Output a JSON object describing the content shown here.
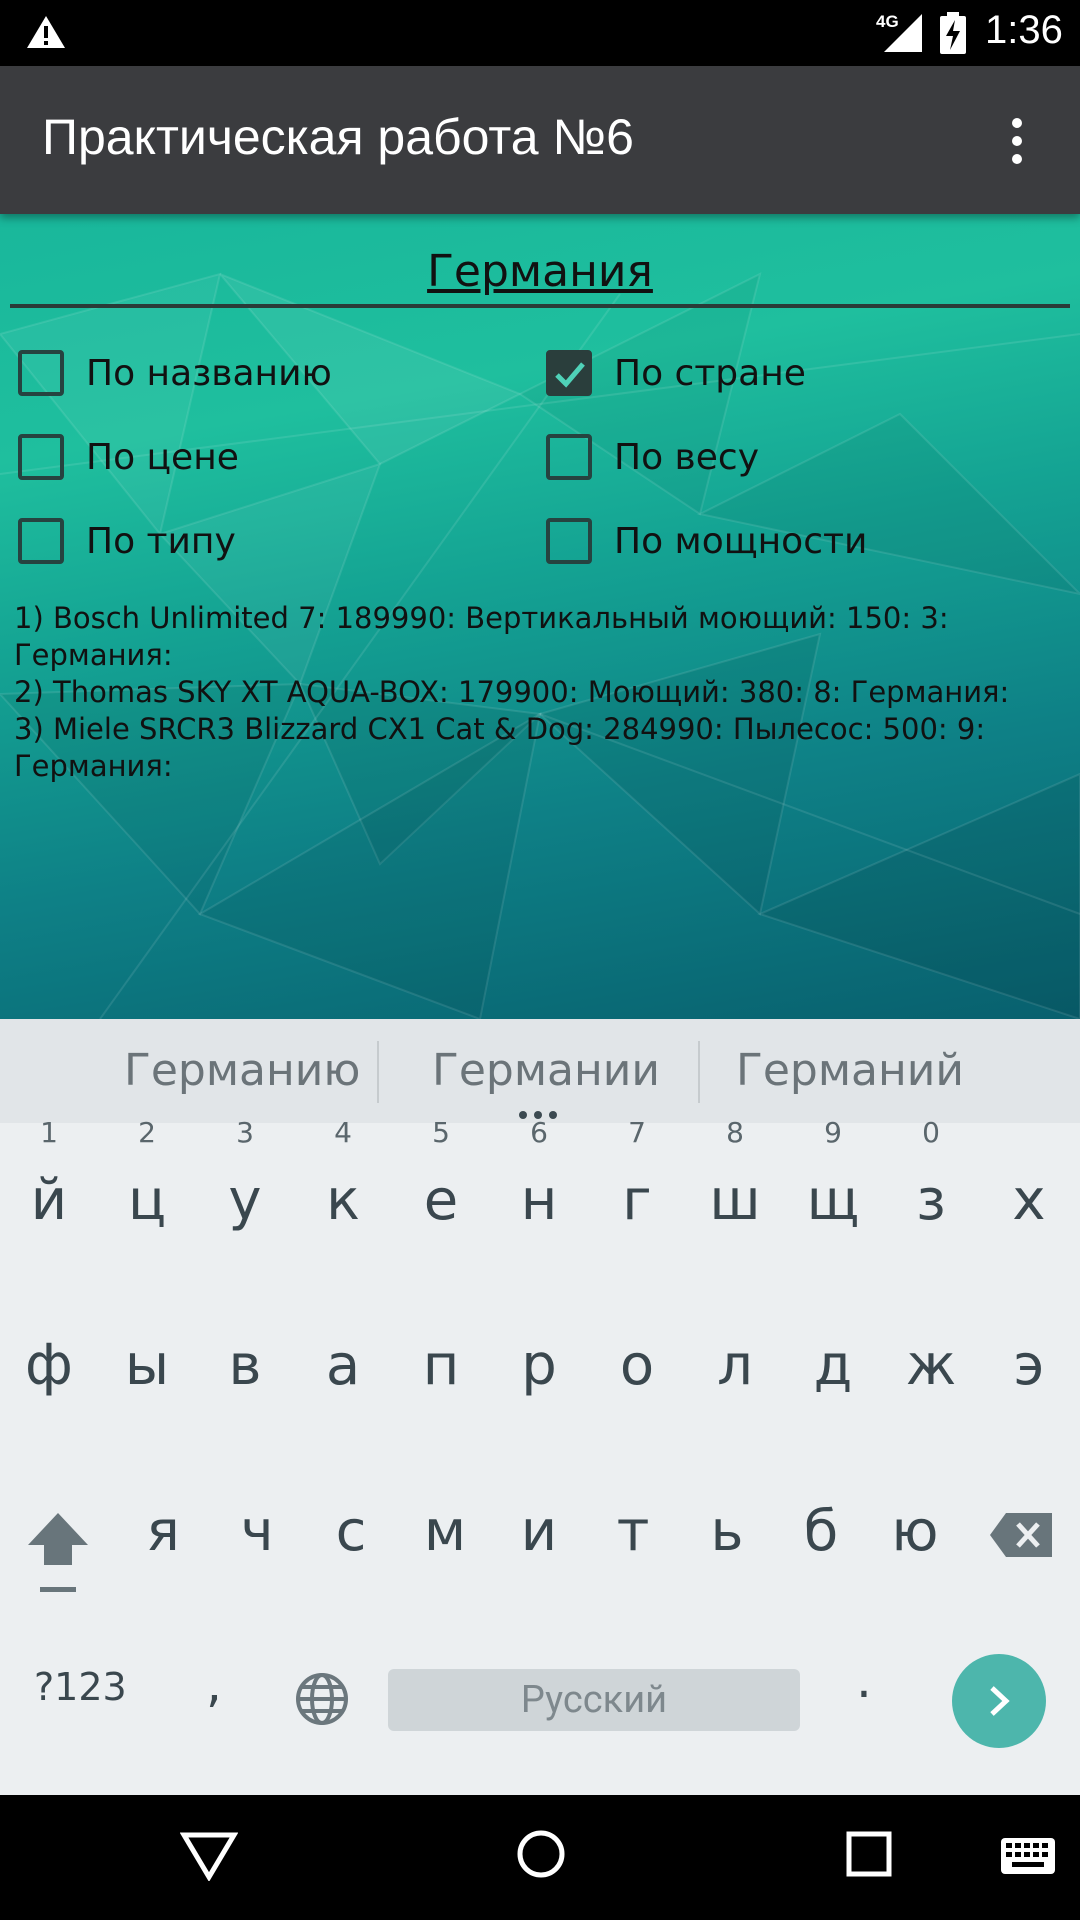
{
  "status_bar": {
    "time": "1:36",
    "network": "4G",
    "icons": [
      "warning-icon",
      "signal-icon",
      "battery-charging-icon"
    ]
  },
  "app_bar": {
    "title": "Практическая работа №6",
    "menu_icon": "overflow-menu-icon"
  },
  "search": {
    "value": "Германия"
  },
  "filters": [
    {
      "label": "По названию",
      "checked": false
    },
    {
      "label": "По стране",
      "checked": true
    },
    {
      "label": "По цене",
      "checked": false
    },
    {
      "label": "По весу",
      "checked": false
    },
    {
      "label": "По типу",
      "checked": false
    },
    {
      "label": "По мощности",
      "checked": false
    }
  ],
  "results": [
    "1) Bosch Unlimited 7: 189990: Вертикальный моющий: 150: 3: Германия:",
    "2) Thomas SKY XT AQUA-BOX: 179900: Моющий: 380: 8: Германия:",
    "3) Miele SRCR3 Blizzard CX1 Cat & Dog: 284990: Пылесос: 500: 9: Германия:"
  ],
  "keyboard": {
    "suggestions": [
      "Германию",
      "Германии",
      "Германий"
    ],
    "row1": [
      "й",
      "ц",
      "у",
      "к",
      "е",
      "н",
      "г",
      "ш",
      "щ",
      "з",
      "х"
    ],
    "row1_hints": [
      "1",
      "2",
      "3",
      "4",
      "5",
      "6",
      "7",
      "8",
      "9",
      "0",
      ""
    ],
    "row2": [
      "ф",
      "ы",
      "в",
      "а",
      "п",
      "р",
      "о",
      "л",
      "д",
      "ж",
      "э"
    ],
    "row3": [
      "я",
      "ч",
      "с",
      "м",
      "и",
      "т",
      "ь",
      "б",
      "ю"
    ],
    "symbols_label": "?123",
    "comma": ",",
    "space_label": "Русский",
    "period": ".",
    "accent_color": "#4db6ac"
  },
  "nav_bar": {
    "icons": [
      "back-icon",
      "home-icon",
      "recents-icon",
      "keyboard-switch-icon"
    ]
  }
}
